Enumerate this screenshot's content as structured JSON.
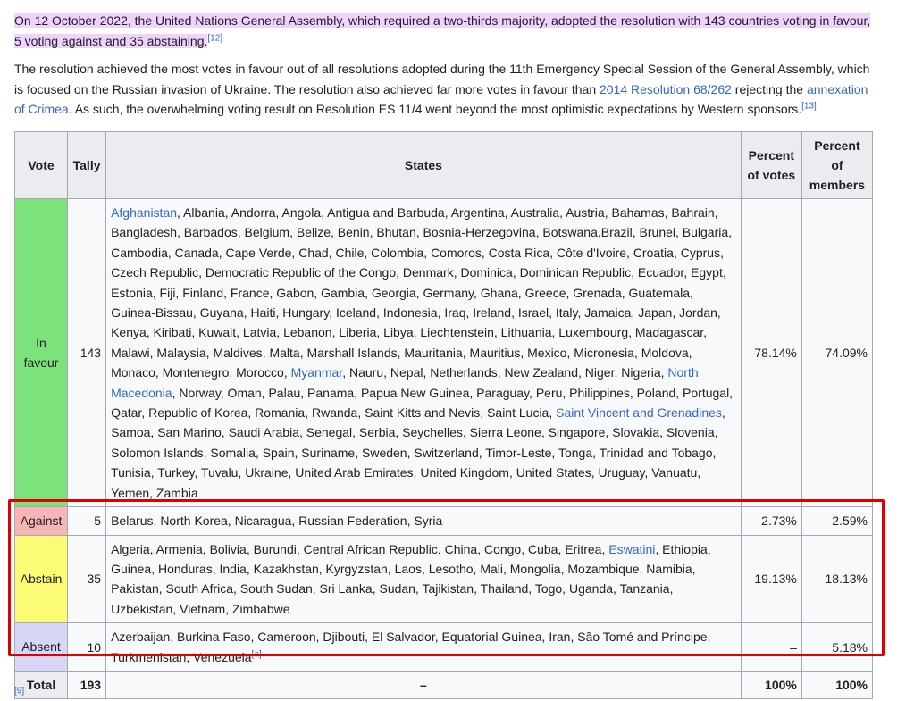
{
  "paragraph1": {
    "text": "On 12 October 2022, the United Nations General Assembly, which required a two-thirds majority, adopted the resolution with 143 countries voting in favour, 5 voting against and 35 abstaining.",
    "ref": "[12]"
  },
  "paragraph2": {
    "t1": "The resolution achieved the most votes in favour out of all resolutions adopted during the 11th Emergency Special Session of the General Assembly, which is focused on the Russian invasion of Ukraine. The resolution also achieved far more votes in favour than ",
    "link1": "2014 Resolution 68/262",
    "t2": " rejecting the ",
    "link2": "annexation of Crimea",
    "t3": ". As such, the overwhelming voting result on Resolution ES 11/4 went beyond the most optimistic expectations by Western sponsors.",
    "ref": "[13]"
  },
  "table": {
    "headers": {
      "vote": "Vote",
      "tally": "Tally",
      "states": "States",
      "pct_votes": "Percent of votes",
      "pct_members": "Percent of members"
    },
    "favour": {
      "vote": "In favour",
      "tally": "143",
      "link_a": "Afghanistan",
      "s1": ", Albania, Andorra, Angola, Antigua and Barbuda, Argentina, Australia, Austria, Bahamas, Bahrain, Bangladesh, Barbados, Belgium, Belize, Benin, Bhutan, Bosnia-Herzegovina, Botswana,Brazil, Brunei, Bulgaria, Cambodia, Canada, Cape Verde, Chad, Chile, Colombia, Comoros, Costa Rica, Côte d'Ivoire, Croatia, Cyprus, Czech Republic, Democratic Republic of the Congo, Denmark, Dominica, Dominican Republic, Ecuador, Egypt, Estonia, Fiji, Finland, France, Gabon, Gambia, Georgia, Germany, Ghana, Greece, Grenada, Guatemala, Guinea-Bissau, Guyana, Haiti, Hungary, Iceland, Indonesia, Iraq, Ireland, Israel, Italy, Jamaica, Japan, Jordan, Kenya, Kiribati, Kuwait, Latvia, Lebanon, Liberia, Libya, Liechtenstein, Lithuania, Luxembourg, Madagascar, Malawi, Malaysia, Maldives, Malta, Marshall Islands, Mauritania, Mauritius, Mexico, Micronesia, Moldova, Monaco, Montenegro, Morocco, ",
      "link_b": "Myanmar",
      "s2": ", Nauru, Nepal, Netherlands, New Zealand, Niger, Nigeria, ",
      "link_c": "North Macedonia",
      "s3": ", Norway, Oman, Palau, Panama, Papua New Guinea, Paraguay, Peru, Philippines, Poland, Portugal, Qatar, Republic of Korea, Romania, Rwanda, Saint Kitts and Nevis, Saint Lucia, ",
      "link_d": "Saint Vincent and Grenadines",
      "s4": ", Samoa, San Marino, Saudi Arabia, Senegal, Serbia, Seychelles, Sierra Leone, Singapore, Slovakia, Slovenia, Solomon Islands, Somalia, Spain, Suriname, Sweden, Switzerland, Timor-Leste, Tonga, Trinidad and Tobago, Tunisia, Turkey, Tuvalu, Ukraine, United Arab Emirates, United Kingdom, United States, Uruguay, Vanuatu, Yemen, Zambia",
      "pct_votes": "78.14%",
      "pct_members": "74.09%"
    },
    "against": {
      "vote": "Against",
      "tally": "5",
      "states": "Belarus, North Korea, Nicaragua, Russian Federation, Syria",
      "pct_votes": "2.73%",
      "pct_members": "2.59%"
    },
    "abstain": {
      "vote": "Abstain",
      "tally": "35",
      "s1": "Algeria, Armenia, Bolivia, Burundi, Central African Republic, China, Congo, Cuba, Eritrea, ",
      "link_a": "Eswatini",
      "s2": ", Ethiopia, Guinea, Honduras, India, Kazakhstan, Kyrgyzstan, Laos, Lesotho, Mali, Mongolia, Mozambique, Namibia, Pakistan, South Africa, South Sudan, Sri Lanka, Sudan, Tajikistan, Thailand, Togo, Uganda, Tanzania, Uzbekistan, Vietnam, Zimbabwe",
      "pct_votes": "19.13%",
      "pct_members": "18.13%"
    },
    "absent": {
      "vote": "Absent",
      "tally": "10",
      "states": "Azerbaijan, Burkina Faso, Cameroon, Djibouti, El Salvador, Equatorial Guinea, Iran, São Tomé and Príncipe, Turkmenistan, Venezuela",
      "note": "[a]",
      "pct_votes": "–",
      "pct_members": "5.18%"
    },
    "total": {
      "label": "Total",
      "tally": "193",
      "states": "–",
      "pct_votes": "100%",
      "pct_members": "100%"
    }
  },
  "source": {
    "ref": "[9]"
  },
  "colors": {
    "favour": "#7ce37c",
    "against": "#f8b5b5",
    "abstain": "#fbfb76",
    "absent": "#d6d6f6",
    "highlight": "#f0d2fc",
    "annotation_box": "#e00000",
    "link": "#3366cc"
  }
}
